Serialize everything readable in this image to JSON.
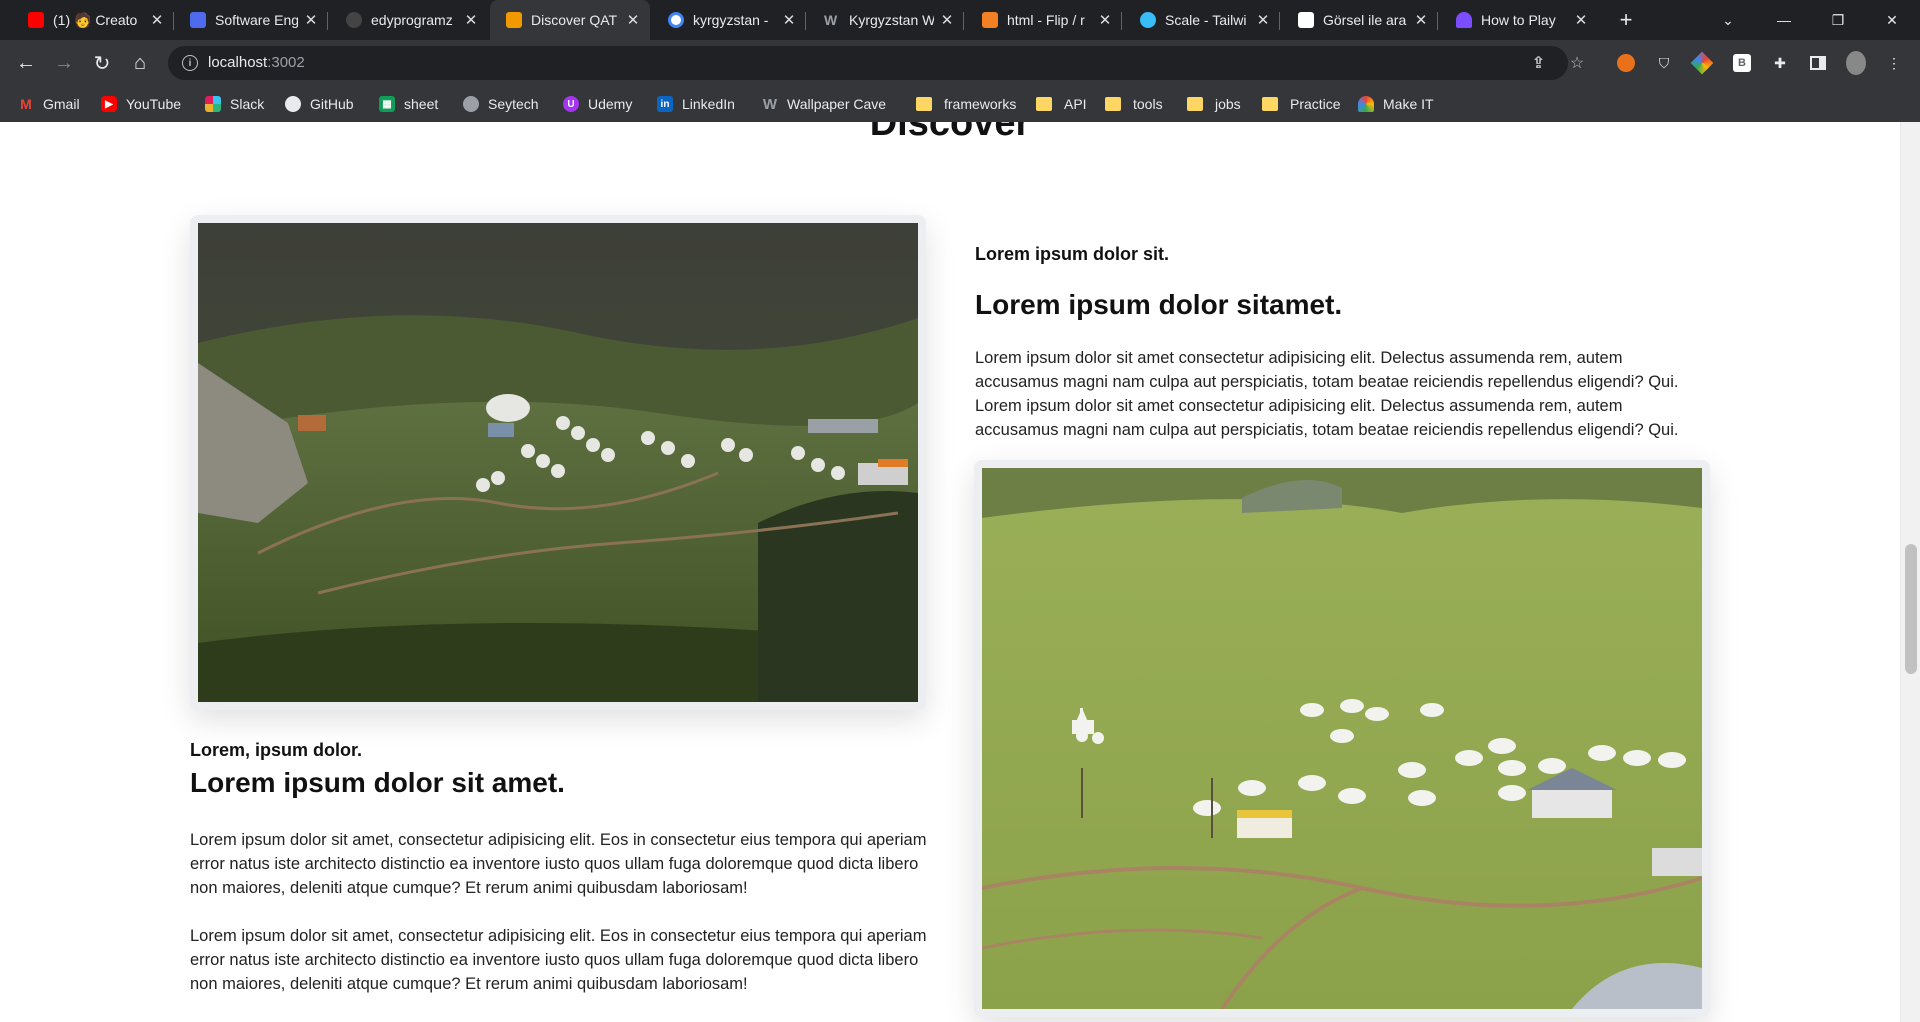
{
  "browser": {
    "tabs": [
      {
        "label": "(1) 🧑 Creato",
        "favicon_color": "#ff0000",
        "active": false
      },
      {
        "label": "Software Engi",
        "favicon_color": "#4f6bed",
        "active": false
      },
      {
        "label": "edyprogramz",
        "favicon_color": "#444444",
        "active": false
      },
      {
        "label": "Discover QAT",
        "favicon_color": "#f29900",
        "active": true
      },
      {
        "label": "kyrgyzstan -",
        "favicon_color": "#4285f4",
        "active": false
      },
      {
        "label": "Kyrgyzstan W",
        "favicon_color": "#9aa0a6",
        "active": false
      },
      {
        "label": "html - Flip / r",
        "favicon_color": "#f48024",
        "active": false
      },
      {
        "label": "Scale - Tailwi",
        "favicon_color": "#38bdf8",
        "active": false
      },
      {
        "label": "Görsel ile ara",
        "favicon_color": "#ffffff",
        "active": false
      },
      {
        "label": "How to Play",
        "favicon_color": "#7c4dff",
        "active": false
      }
    ],
    "new_tab_label": "+",
    "address": {
      "host": "localhost",
      "port": ":3002"
    },
    "bookmarks": [
      {
        "label": "Gmail",
        "kind": "site",
        "color": "#ea4335"
      },
      {
        "label": "YouTube",
        "kind": "site",
        "color": "#ff0000"
      },
      {
        "label": "Slack",
        "kind": "site",
        "color": "#4a154b"
      },
      {
        "label": "GitHub",
        "kind": "site",
        "color": "#e8eaed"
      },
      {
        "label": "sheet",
        "kind": "site",
        "color": "#0f9d58"
      },
      {
        "label": "Seytech",
        "kind": "site",
        "color": "#9aa0a6"
      },
      {
        "label": "Udemy",
        "kind": "site",
        "color": "#a435f0"
      },
      {
        "label": "LinkedIn",
        "kind": "site",
        "color": "#0a66c2"
      },
      {
        "label": "Wallpaper Cave",
        "kind": "site",
        "color": "#9aa0a6"
      },
      {
        "label": "frameworks",
        "kind": "folder"
      },
      {
        "label": "API",
        "kind": "folder"
      },
      {
        "label": "tools",
        "kind": "folder"
      },
      {
        "label": "jobs",
        "kind": "folder"
      },
      {
        "label": "Practice",
        "kind": "folder"
      },
      {
        "label": "Make IT",
        "kind": "site",
        "color": "#e8eaed"
      }
    ]
  },
  "page": {
    "section_title": "Discover",
    "block1": {
      "eyebrow": "Lorem, ipsum dolor.",
      "heading": "Lorem ipsum dolor sit amet.",
      "paragraph1": "Lorem ipsum dolor sit amet, consectetur adipisicing elit. Eos in consectetur eius tempora qui aperiam error natus iste architecto distinctio ea inventore iusto quos ullam fuga doloremque quod dicta libero non maiores, deleniti atque cumque? Et rerum animi quibusdam laboriosam!",
      "paragraph2": "Lorem ipsum dolor sit amet, consectetur adipisicing elit. Eos in consectetur eius tempora qui aperiam error natus iste architecto distinctio ea inventore iusto quos ullam fuga doloremque quod dicta libero non maiores, deleniti atque cumque? Et rerum animi quibusdam laboriosam!"
    },
    "block2": {
      "eyebrow": "Lorem ipsum dolor sit.",
      "heading": "Lorem ipsum dolor sitamet.",
      "paragraph": "Lorem ipsum dolor sit amet consectetur adipisicing elit. Delectus assumenda rem, autem accusamus magni nam culpa aut perspiciatis, totam beatae reiciendis repellendus eligendi? Qui. Lorem ipsum dolor sit amet consectetur adipisicing elit. Delectus assumenda rem, autem accusamus magni nam culpa aut perspiciatis, totam beatae reiciendis repellendus eligendi? Qui."
    }
  }
}
